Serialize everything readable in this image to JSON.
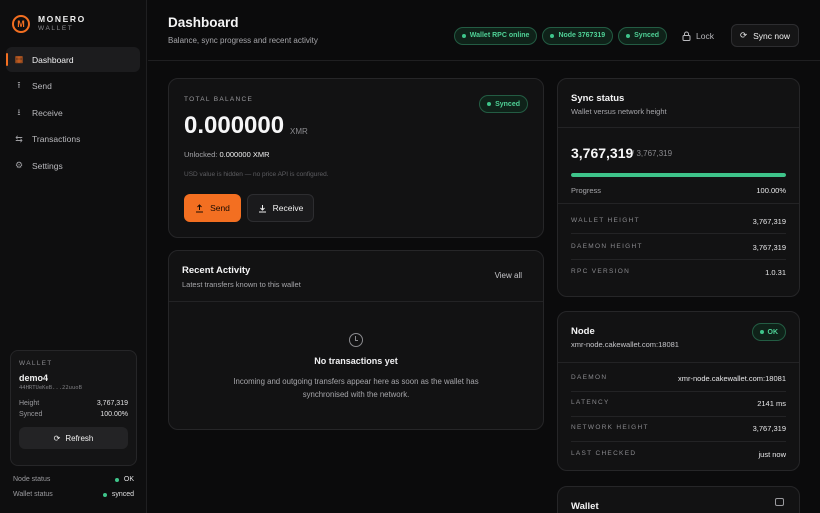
{
  "brand": {
    "name": "MONERO",
    "sub": "WALLET",
    "logo_letter": "M"
  },
  "sidebar": {
    "items": [
      {
        "label": "Dashboard",
        "icon": "grid-icon",
        "active": true
      },
      {
        "label": "Send",
        "icon": "upload-icon"
      },
      {
        "label": "Receive",
        "icon": "download-icon"
      },
      {
        "label": "Transactions",
        "icon": "arrows-icon"
      },
      {
        "label": "Settings",
        "icon": "gear-icon"
      }
    ],
    "wallet": {
      "label": "WALLET",
      "name": "demo4",
      "address": "44HRTUeKeB...22uuoB",
      "height_label": "Height",
      "height": "3,767,319",
      "synced_label": "Synced",
      "synced": "100.00%",
      "refresh_label": "Refresh"
    },
    "status": {
      "node_label": "Node status",
      "node_value": "OK",
      "wallet_label": "Wallet status",
      "wallet_value": "synced"
    }
  },
  "header": {
    "title": "Dashboard",
    "subtitle": "Balance, sync progress and recent activity",
    "pills": [
      "Wallet RPC online",
      "Node 3767319",
      "Synced"
    ],
    "lock_label": "Lock",
    "sync_label": "Sync now"
  },
  "balance": {
    "label": "TOTAL BALANCE",
    "amount": "0.000000",
    "unit": "XMR",
    "unlocked_label": "Unlocked:",
    "unlocked_value": "0.000000 XMR",
    "note": "USD value is hidden — no price API is configured.",
    "status": "Synced",
    "send_label": "Send",
    "receive_label": "Receive"
  },
  "activity": {
    "title": "Recent Activity",
    "subtitle": "Latest transfers known to this wallet",
    "view_all": "View all",
    "empty_title": "No transactions yet",
    "empty_text": "Incoming and outgoing transfers appear here as soon as the wallet has synchronised with the network."
  },
  "sync": {
    "title": "Sync status",
    "subtitle": "Wallet versus network height",
    "height": "3,767,319",
    "of": "/ 3,767,319",
    "progress_fraction": 1.0,
    "progress_label": "Progress",
    "progress_value": "100.00%",
    "rows": [
      {
        "k": "WALLET HEIGHT",
        "v": "3,767,319"
      },
      {
        "k": "DAEMON HEIGHT",
        "v": "3,767,319"
      },
      {
        "k": "RPC VERSION",
        "v": "1.0.31"
      }
    ]
  },
  "node": {
    "title": "Node",
    "host": "xmr-node.cakewallet.com:18081",
    "status": "OK",
    "rows": [
      {
        "k": "DAEMON",
        "v": "xmr-node.cakewallet.com:18081"
      },
      {
        "k": "LATENCY",
        "v": "2141 ms"
      },
      {
        "k": "NETWORK HEIGHT",
        "v": "3,767,319"
      },
      {
        "k": "LAST CHECKED",
        "v": "just now"
      }
    ]
  },
  "wallet_card": {
    "title": "Wallet"
  },
  "colors": {
    "accent": "#f36f21",
    "success": "#3ec48a",
    "background": "#0b0b0c"
  }
}
